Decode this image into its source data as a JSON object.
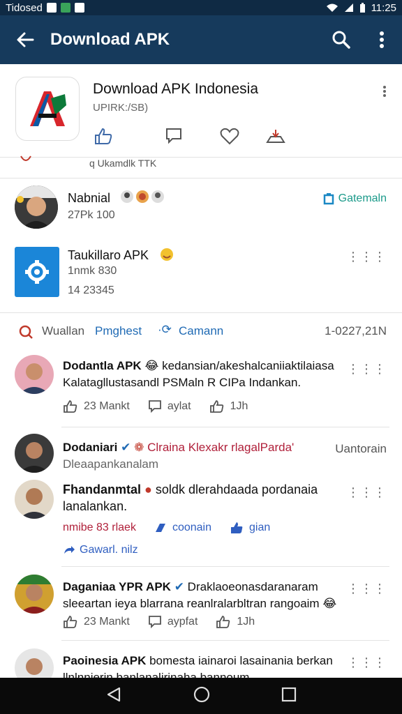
{
  "status_bar": {
    "left_text": "Tidosed",
    "time": "11:25"
  },
  "app_bar": {
    "title": "Download APK",
    "icons": [
      "back-arrow-icon",
      "search-icon",
      "overflow-menu-icon"
    ]
  },
  "app": {
    "name": "Download APK Indonesia",
    "sub": "UPIRK:/SB)",
    "partial_line": "q Ukamdlk TTK"
  },
  "people": [
    {
      "name": "Nabnial",
      "sub": "27Pk 100",
      "action": "Gatemaln",
      "action_color": "#1b9a8a"
    },
    {
      "name": "Taukillaro APK",
      "sub": "1nmk 830",
      "sub2": "14 23345"
    }
  ],
  "feed_header": {
    "left": "Wuallan",
    "highlight": "Pmghest",
    "middle": "Camann",
    "right": "1-0227,21N"
  },
  "posts": [
    {
      "text1": "Dodantla APK",
      "text1b": "kedansian/akeshalcaniiaktilaiasa",
      "text2": "Kalatagllustasandl PSMaln R CIPa Indankan.",
      "like": "23 Mankt",
      "comment": "aylat",
      "share": "1Jh"
    },
    {
      "text1": "Dodaniari",
      "text1b": "Clraina Klexakr rlagalParda'",
      "text2": "Dleaapankanalam",
      "right": "Uantorain"
    },
    {
      "text1": "Fhandanmtal",
      "text1b": "soldk dlerahdaada pordanaia",
      "text2": "lanalankan.",
      "react": "nmibe 83 rlaek",
      "link2": "coonain",
      "link3": "gian",
      "extra": "Gawarl. nilz"
    },
    {
      "text1": "Daganiaa YPR APK",
      "text1b": "Draklaoeonasdaranaram",
      "text2": "sleeartan ieya blarrana reanlralarbltran rangoaim",
      "like": "23 Mankt",
      "comment": "aypfat",
      "share": "1Jh"
    },
    {
      "text1": "Paoinesia APK",
      "text1b": "bomesta iainaroi lasainania berkan",
      "text2": "llnlnnierin banlanalirinaha bannoum"
    }
  ]
}
